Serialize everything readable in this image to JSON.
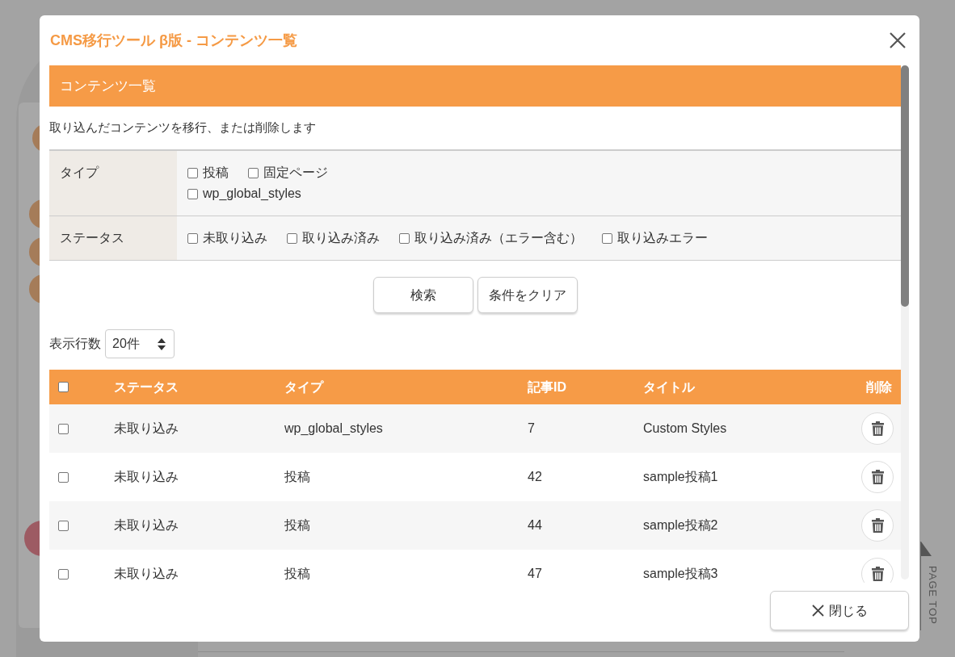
{
  "window": {
    "title": "CMS移行ツール β版 - コンテンツ一覧"
  },
  "section": {
    "heading": "コンテンツ一覧",
    "description": "取り込んだコンテンツを移行、または削除します"
  },
  "filters": [
    {
      "label": "タイプ",
      "options": [
        {
          "label": "投稿",
          "checked": false
        },
        {
          "label": "固定ページ",
          "checked": false
        },
        {
          "label": "wp_global_styles",
          "checked": false
        }
      ]
    },
    {
      "label": "ステータス",
      "options": [
        {
          "label": "未取り込み",
          "checked": false
        },
        {
          "label": "取り込み済み",
          "checked": false
        },
        {
          "label": "取り込み済み（エラー含む）",
          "checked": false
        },
        {
          "label": "取り込みエラー",
          "checked": false
        }
      ]
    }
  ],
  "buttons": [
    {
      "label": "検索"
    },
    {
      "label": "条件をクリア"
    }
  ],
  "rows_per_page": {
    "label": "表示行数",
    "value": "20件"
  },
  "table": {
    "select_all_checked": false,
    "columns": [
      "ステータス",
      "タイプ",
      "記事ID",
      "タイトル",
      "削除"
    ],
    "rows": [
      {
        "checked": false,
        "status": "未取り込み",
        "type": "wp_global_styles",
        "id": "7",
        "title": "Custom Styles"
      },
      {
        "checked": false,
        "status": "未取り込み",
        "type": "投稿",
        "id": "42",
        "title": "sample投稿1"
      },
      {
        "checked": false,
        "status": "未取り込み",
        "type": "投稿",
        "id": "44",
        "title": "sample投稿2"
      },
      {
        "checked": false,
        "status": "未取り込み",
        "type": "投稿",
        "id": "47",
        "title": "sample投稿3"
      }
    ]
  },
  "close_button": {
    "label": "閉じる"
  },
  "page_top": {
    "label": "PAGE TOP"
  }
}
